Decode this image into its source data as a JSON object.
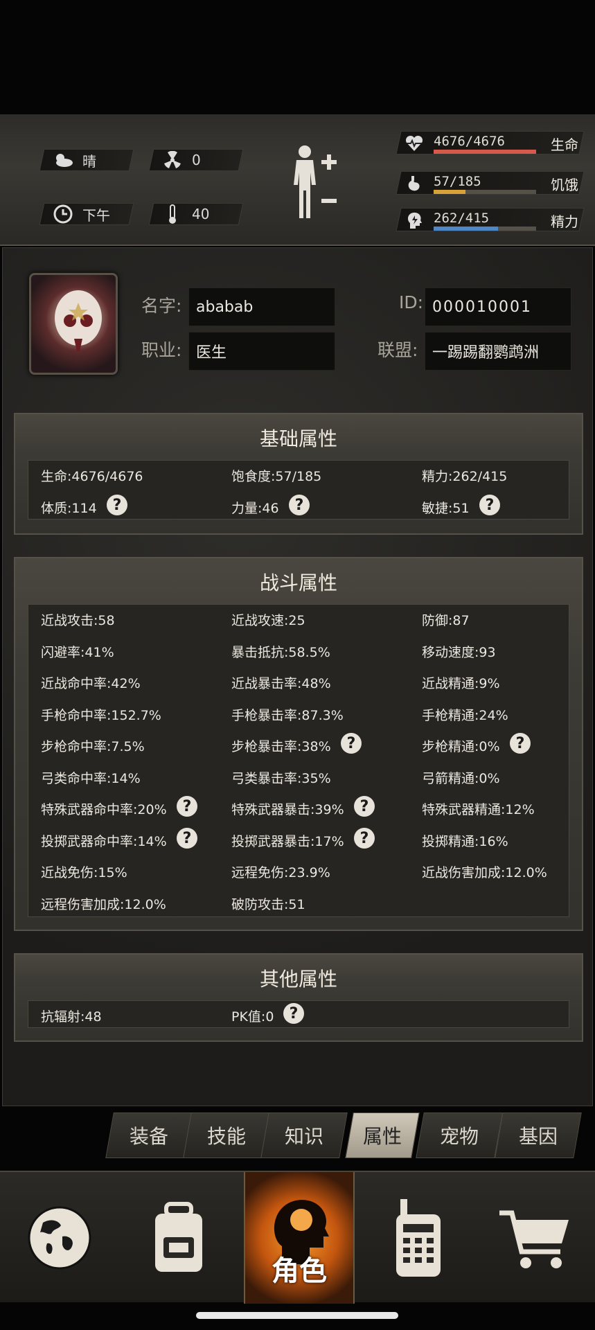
{
  "status": {
    "weather": "晴",
    "radiation": "0",
    "time_of_day": "下午",
    "temperature": "40",
    "bars": [
      {
        "value": "4676/4676",
        "label": "生命",
        "fraction": 1.0,
        "color": "#d65a4c",
        "icon": "heart-pulse-icon"
      },
      {
        "value": "57/185",
        "label": "饥饿",
        "fraction": 0.31,
        "color": "#d8a23a",
        "icon": "stomach-icon"
      },
      {
        "value": "262/415",
        "label": "精力",
        "fraction": 0.63,
        "color": "#4f86c6",
        "icon": "head-energy-icon"
      }
    ]
  },
  "profile": {
    "name_label": "名字:",
    "name_value": "ababab",
    "job_label": "职业:",
    "job_value": "医生",
    "id_label": "ID:",
    "id_value": "000010001",
    "alliance_label": "联盟:",
    "alliance_value": "一踢踢翻鹦鹉洲"
  },
  "basic": {
    "title": "基础属性",
    "stats": [
      {
        "text": "生命:4676/4676",
        "help": false
      },
      {
        "text": "饱食度:57/185",
        "help": false
      },
      {
        "text": "精力:262/415",
        "help": false
      },
      {
        "text": "体质:114",
        "help": true
      },
      {
        "text": "力量:46",
        "help": true
      },
      {
        "text": "敏捷:51",
        "help": true
      }
    ]
  },
  "combat": {
    "title": "战斗属性",
    "stats": [
      {
        "text": "近战攻击:58",
        "help": false
      },
      {
        "text": "近战攻速:25",
        "help": false
      },
      {
        "text": "防御:87",
        "help": false
      },
      {
        "text": "闪避率:41%",
        "help": false
      },
      {
        "text": "暴击抵抗:58.5%",
        "help": false
      },
      {
        "text": "移动速度:93",
        "help": false
      },
      {
        "text": "近战命中率:42%",
        "help": false
      },
      {
        "text": "近战暴击率:48%",
        "help": false
      },
      {
        "text": "近战精通:9%",
        "help": false
      },
      {
        "text": "手枪命中率:152.7%",
        "help": false
      },
      {
        "text": "手枪暴击率:87.3%",
        "help": false
      },
      {
        "text": "手枪精通:24%",
        "help": false
      },
      {
        "text": "步枪命中率:7.5%",
        "help": false
      },
      {
        "text": "步枪暴击率:38%",
        "help": true
      },
      {
        "text": "步枪精通:0%",
        "help": true
      },
      {
        "text": "弓类命中率:14%",
        "help": false
      },
      {
        "text": "弓类暴击率:35%",
        "help": false
      },
      {
        "text": "弓箭精通:0%",
        "help": false
      },
      {
        "text": "特殊武器命中率:20%",
        "help": true
      },
      {
        "text": "特殊武器暴击:39%",
        "help": true
      },
      {
        "text": "特殊武器精通:12%",
        "help": false
      },
      {
        "text": "投掷武器命中率:14%",
        "help": true
      },
      {
        "text": "投掷武器暴击:17%",
        "help": true
      },
      {
        "text": "投掷精通:16%",
        "help": false
      },
      {
        "text": "近战免伤:15%",
        "help": false
      },
      {
        "text": "远程免伤:23.9%",
        "help": false
      },
      {
        "text": "近战伤害加成:12.0%",
        "help": false
      },
      {
        "text": "远程伤害加成:12.0%",
        "help": false
      },
      {
        "text": "破防攻击:51",
        "help": false
      }
    ]
  },
  "other": {
    "title": "其他属性",
    "stats": [
      {
        "text": "抗辐射:48",
        "help": false
      },
      {
        "text": "PK值:0",
        "help": true
      }
    ]
  },
  "help_glyph": "?",
  "tabs": [
    {
      "label": "装备",
      "active": false
    },
    {
      "label": "技能",
      "active": false
    },
    {
      "label": "知识",
      "active": false
    },
    {
      "label": "属性",
      "active": true
    },
    {
      "label": "宠物",
      "active": false
    },
    {
      "label": "基因",
      "active": false
    }
  ],
  "nav": {
    "active_label": "角色",
    "items": [
      "globe-icon",
      "backpack-icon",
      "character-head-icon",
      "walkie-talkie-icon",
      "shopping-cart-icon"
    ]
  }
}
